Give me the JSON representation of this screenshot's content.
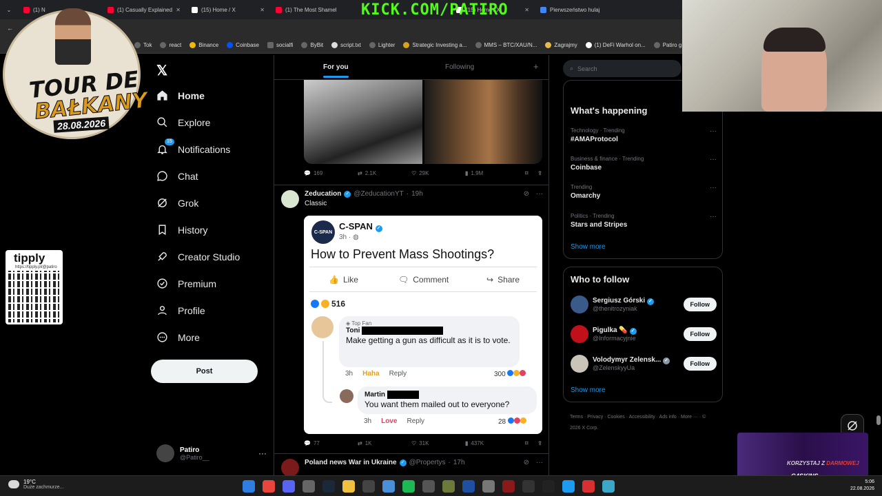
{
  "browser": {
    "tabs": [
      {
        "label": "(1) N",
        "color": "#ff0033"
      },
      {
        "label": "(1) Casually Explained",
        "color": "#ff0033"
      },
      {
        "label": "(15) Home / X",
        "color": "#ffffff"
      },
      {
        "label": "(1) The Most Shamel",
        "color": "#ff0033"
      },
      {
        "label": "(15) Home / X",
        "color": "#ffffff"
      },
      {
        "label": "Pierwszeństwo hulaj",
        "color": "#4285f4"
      }
    ],
    "stream_url": "KICK.COM/PATIRO",
    "bookmarks": [
      "Tok",
      "react",
      "Binance",
      "Coinbase",
      "socialfi",
      "ByBit",
      "script.txt",
      "Lighter",
      "Strategic Investing a...",
      "MMS – BTC/XAU/N...",
      "Zagrajmy",
      "(1) DeFi Warhol on...",
      "Patiro g"
    ]
  },
  "nav": {
    "items": [
      {
        "label": "Home",
        "icon": "home-icon"
      },
      {
        "label": "Explore",
        "icon": "search-icon"
      },
      {
        "label": "Notifications",
        "icon": "bell-icon"
      },
      {
        "label": "Chat",
        "icon": "chat-icon"
      },
      {
        "label": "Grok",
        "icon": "grok-icon"
      },
      {
        "label": "History",
        "icon": "bookmark-icon"
      },
      {
        "label": "Creator Studio",
        "icon": "rocket-icon"
      },
      {
        "label": "Premium",
        "icon": "premium-icon"
      },
      {
        "label": "Profile",
        "icon": "profile-icon"
      },
      {
        "label": "More",
        "icon": "more-icon"
      }
    ],
    "notifications_badge": "15",
    "post_label": "Post",
    "account": {
      "name": "Patiro",
      "handle": "@Patiro__"
    }
  },
  "feed": {
    "tabs": {
      "active": "For you",
      "other": "Following"
    },
    "tweet1_actions": {
      "replies": "169",
      "reposts": "2.1K",
      "likes": "29K",
      "views": "1.9M"
    },
    "tweet2": {
      "name": "Zeducation",
      "handle": "@ZeducationYT",
      "time": "19h",
      "text": "Classic",
      "actions": {
        "replies": "77",
        "reposts": "1K",
        "likes": "31K",
        "views": "437K"
      },
      "embed": {
        "page_name": "C-SPAN",
        "logo_text": "C-SPAN",
        "time": "3h ·",
        "question": "How to Prevent Mass Shootings?",
        "like": "Like",
        "comment": "Comment",
        "share": "Share",
        "reaction_count": "516",
        "comment1": {
          "badge": "Top Fan",
          "name": "Toni",
          "text": "Make getting a gun as difficult as it is to vote.",
          "time": "3h",
          "reaction": "Haha",
          "reply": "Reply",
          "count": "300"
        },
        "comment2": {
          "name": "Martin",
          "text": "You want them mailed out to everyone?",
          "time": "3h",
          "reaction": "Love",
          "reply": "Reply",
          "count": "28"
        }
      }
    },
    "tweet3": {
      "name": "Poland news War in Ukraine",
      "handle": "@Propertys",
      "time": "17h"
    }
  },
  "right": {
    "search_placeholder": "Search",
    "happening_title": "What's happening",
    "trends": [
      {
        "cat": "Technology · Trending",
        "topic": "#AMAProtocol"
      },
      {
        "cat": "Business & finance · Trending",
        "topic": "Coinbase"
      },
      {
        "cat": "Trending",
        "topic": "Omarchy"
      },
      {
        "cat": "Politics · Trending",
        "topic": "Stars and Stripes"
      }
    ],
    "show_more": "Show more",
    "wtf_title": "Who to follow",
    "who_to_follow": [
      {
        "name": "Sergiusz Górski",
        "handle": "@thenitrozyniak",
        "color": "#3a5a8a"
      },
      {
        "name": "Pigulka 💊",
        "handle": "@Informacyjnie",
        "color": "#c0101a"
      },
      {
        "name": "Volodymyr Zelensk...",
        "handle": "@ZelenskyyUa",
        "color": "#c9c3b8"
      }
    ],
    "follow_label": "Follow",
    "footer": "Terms · Privacy · Cookies · Accessibility · Ads info · More ··· · © 2026 X Corp."
  },
  "overlay": {
    "event_title_1": "TOUR DE",
    "event_title_2": "BAŁKANY",
    "event_date": "28.08.2026",
    "tipply": "tipply",
    "tipply_url": "https://tipply.pl/@patiro",
    "promo_text_1": "KORZYSTAJ Z ",
    "promo_text_2": "DARMOWEJ",
    "promo_brand": "G4SKINS"
  },
  "taskbar": {
    "temp": "19°C",
    "weather": "Duże zachmurze...",
    "time": "5:06",
    "date": "22.08.2026"
  }
}
